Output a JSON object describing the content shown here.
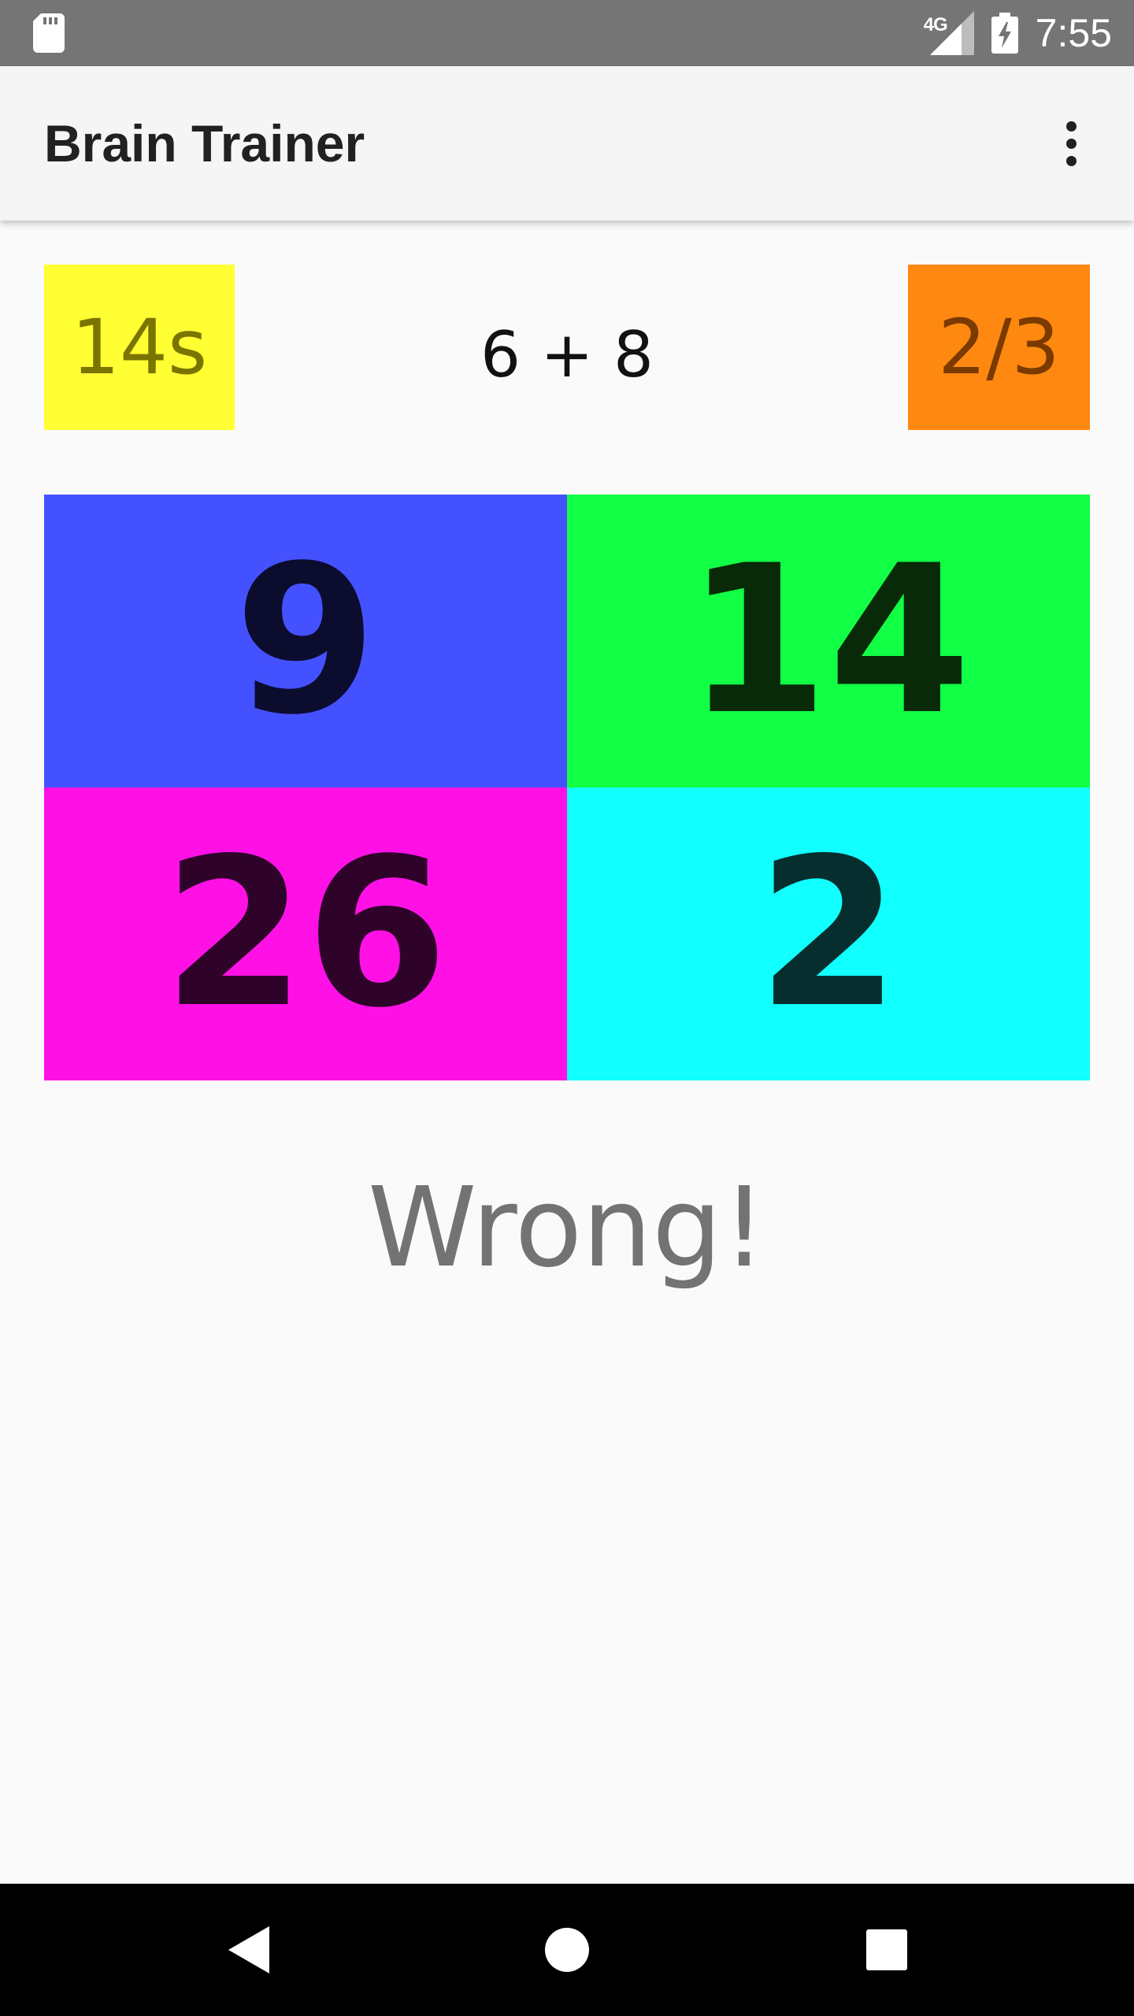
{
  "status_bar": {
    "network": "4G",
    "time": "7:55"
  },
  "app_bar": {
    "title": "Brain Trainer"
  },
  "game": {
    "timer": "14s",
    "question": "6 + 8",
    "score": "2/3",
    "answers": [
      "9",
      "14",
      "26",
      "2"
    ],
    "result": "Wrong!"
  },
  "colors": {
    "timer_bg": "#ffff33",
    "score_bg": "#ff8811",
    "answer_bgs": [
      "#4451ff",
      "#11ff44",
      "#ff11e6",
      "#11ffff"
    ],
    "answer_text": [
      "#0c0c2e",
      "#082a08",
      "#2e0229",
      "#062e2e"
    ]
  },
  "icons": {
    "status": [
      "sd-card-icon",
      "signal-icon",
      "battery-charging-icon"
    ],
    "app_bar": [
      "more-vert-icon"
    ],
    "nav": [
      "back-icon",
      "home-icon",
      "recents-icon"
    ]
  }
}
